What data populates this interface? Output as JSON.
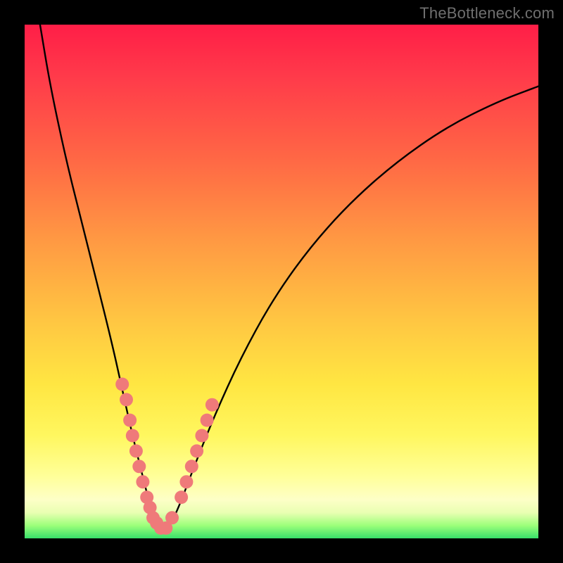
{
  "watermark": "TheBottleneck.com",
  "chart_data": {
    "type": "line",
    "title": "",
    "xlabel": "",
    "ylabel": "",
    "xlim": [
      0,
      100
    ],
    "ylim": [
      0,
      100
    ],
    "background_gradient": {
      "stops": [
        {
          "pos": 0.0,
          "color": "#ff1e47"
        },
        {
          "pos": 0.26,
          "color": "#ff6745"
        },
        {
          "pos": 0.58,
          "color": "#ffc742"
        },
        {
          "pos": 0.8,
          "color": "#fff75f"
        },
        {
          "pos": 0.93,
          "color": "#fdffc7"
        },
        {
          "pos": 1.0,
          "color": "#38e06a"
        }
      ]
    },
    "series": [
      {
        "name": "bottleneck-curve",
        "stroke": "#000000",
        "x": [
          3,
          5,
          8,
          11,
          14,
          17,
          19,
          21,
          23,
          24.5,
          26,
          28,
          30,
          33,
          37,
          42,
          48,
          55,
          63,
          72,
          82,
          92,
          100
        ],
        "y": [
          100,
          88,
          74,
          62,
          50,
          38,
          29,
          20,
          12,
          6,
          2,
          2,
          6,
          14,
          24,
          35,
          46,
          56,
          65,
          73,
          80,
          85,
          88
        ]
      }
    ],
    "markers": {
      "name": "highlight-dots",
      "color": "#ef7a7a",
      "radius_approx": 1.3,
      "points": [
        {
          "x": 19.0,
          "y": 30
        },
        {
          "x": 19.8,
          "y": 27
        },
        {
          "x": 20.5,
          "y": 23
        },
        {
          "x": 21.0,
          "y": 20
        },
        {
          "x": 21.7,
          "y": 17
        },
        {
          "x": 22.3,
          "y": 14
        },
        {
          "x": 23.0,
          "y": 11
        },
        {
          "x": 23.8,
          "y": 8
        },
        {
          "x": 24.4,
          "y": 6
        },
        {
          "x": 25.0,
          "y": 4
        },
        {
          "x": 25.7,
          "y": 3
        },
        {
          "x": 26.5,
          "y": 2
        },
        {
          "x": 27.5,
          "y": 2
        },
        {
          "x": 28.7,
          "y": 4
        },
        {
          "x": 30.5,
          "y": 8
        },
        {
          "x": 31.5,
          "y": 11
        },
        {
          "x": 32.5,
          "y": 14
        },
        {
          "x": 33.5,
          "y": 17
        },
        {
          "x": 34.5,
          "y": 20
        },
        {
          "x": 35.5,
          "y": 23
        },
        {
          "x": 36.5,
          "y": 26
        }
      ]
    }
  }
}
